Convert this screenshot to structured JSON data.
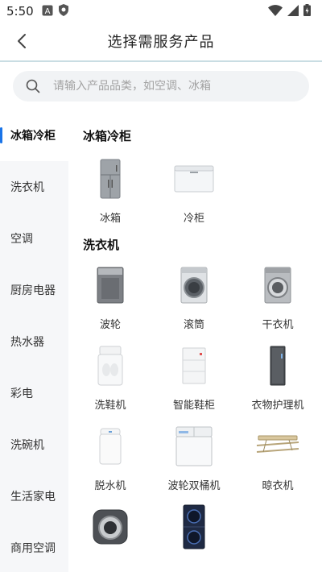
{
  "status_bar": {
    "time": "5:50",
    "left_icons": [
      "notification-a-icon",
      "shield-icon"
    ],
    "right_icons": [
      "wifi-icon",
      "signal-icon",
      "battery-icon"
    ]
  },
  "header": {
    "title": "选择需服务产品",
    "back_icon": "chevron-left-icon"
  },
  "search": {
    "placeholder": "请输入产品品类，如空调、冰箱"
  },
  "sidebar": {
    "items": [
      {
        "label": "冰箱冷柜",
        "active": true
      },
      {
        "label": "洗衣机",
        "active": false
      },
      {
        "label": "空调",
        "active": false
      },
      {
        "label": "厨房电器",
        "active": false
      },
      {
        "label": "热水器",
        "active": false
      },
      {
        "label": "彩电",
        "active": false
      },
      {
        "label": "洗碗机",
        "active": false
      },
      {
        "label": "生活家电",
        "active": false
      },
      {
        "label": "商用空调",
        "active": false
      }
    ]
  },
  "sections": [
    {
      "title": "冰箱冷柜",
      "products": [
        {
          "label": "冰箱",
          "icon": "fridge-icon"
        },
        {
          "label": "冷柜",
          "icon": "chest-freezer-icon"
        }
      ]
    },
    {
      "title": "洗衣机",
      "products": [
        {
          "label": "波轮",
          "icon": "top-load-washer-icon"
        },
        {
          "label": "滚筒",
          "icon": "front-load-washer-icon"
        },
        {
          "label": "干衣机",
          "icon": "dryer-icon"
        },
        {
          "label": "洗鞋机",
          "icon": "shoe-washer-icon"
        },
        {
          "label": "智能鞋柜",
          "icon": "shoe-cabinet-icon"
        },
        {
          "label": "衣物护理机",
          "icon": "clothes-care-icon"
        },
        {
          "label": "脱水机",
          "icon": "spin-dryer-icon"
        },
        {
          "label": "波轮双桶机",
          "icon": "twin-tub-washer-icon"
        },
        {
          "label": "晾衣机",
          "icon": "clothes-rack-icon"
        },
        {
          "label": "",
          "icon": "round-washer-icon"
        },
        {
          "label": "",
          "icon": "stacked-washer-dryer-icon"
        }
      ]
    }
  ],
  "colors": {
    "accent": "#1a74e8",
    "sidebar_bg": "#f6f7f9",
    "search_bg": "#f1f3f5"
  }
}
